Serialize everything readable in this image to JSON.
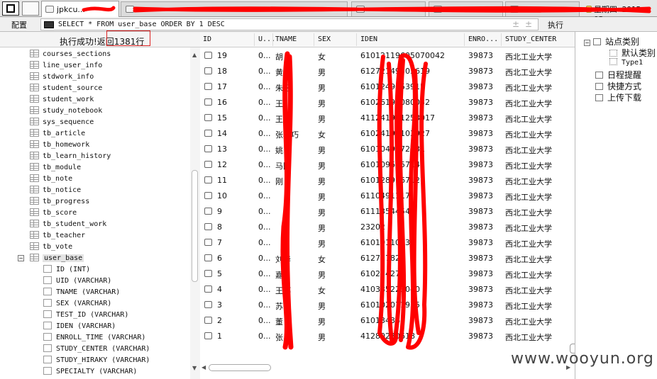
{
  "tabs": {
    "active_label": "jpkcu...",
    "date_label": "星期四 2015-05-"
  },
  "toolbar": {
    "config_label": "配置",
    "sql": "SELECT * FROM user_base ORDER BY 1 DESC",
    "exec_label": "执行",
    "arrow_up": "±",
    "arrow_down": "±"
  },
  "status": {
    "text": "执行成功!返回1381行"
  },
  "tree": {
    "tables": [
      "courses_sections",
      "line_user_info",
      "stdwork_info",
      "student_source",
      "student_work",
      "study_notebook",
      "sys_sequence",
      "tb_article",
      "tb_homework",
      "tb_learn_history",
      "tb_module",
      "tb_note",
      "tb_notice",
      "tb_progress",
      "tb_score",
      "tb_student_work",
      "tb_teacher",
      "tb_vote"
    ],
    "selected": "user_base",
    "columns": [
      "ID (INT)",
      "UID (VARCHAR)",
      "TNAME (VARCHAR)",
      "SEX (VARCHAR)",
      "TEST_ID (VARCHAR)",
      "IDEN (VARCHAR)",
      "ENROLL_TIME (VARCHAR)",
      "STUDY_CENTER (VARCHAR)",
      "STUDY_HIRAKY (VARCHAR)",
      "SPECIALTY (VARCHAR)"
    ]
  },
  "grid": {
    "headers": [
      "ID",
      "U...",
      "TNAME",
      "SEX",
      "IDEN",
      "ENRO...",
      "STUDY_CENTER"
    ],
    "rows": [
      {
        "id": "19",
        "uid": "0...",
        "name": "胡",
        "sex": "女",
        "iden": "61012119605070042",
        "enro": "39873",
        "center": "西北工业大学"
      },
      {
        "id": "18",
        "uid": "0...",
        "name": "黄",
        "sex": "男",
        "iden": "61272149503619",
        "enro": "39873",
        "center": "西北工业大学"
      },
      {
        "id": "17",
        "uid": "0...",
        "name": "朱召",
        "sex": "男",
        "iden": "6101249653915",
        "enro": "39873",
        "center": "西北工业大学"
      },
      {
        "id": "16",
        "uid": "0...",
        "name": "王",
        "sex": "男",
        "iden": "61026198080032",
        "enro": "39873",
        "center": "西北工业大学"
      },
      {
        "id": "15",
        "uid": "0...",
        "name": "王光",
        "sex": "男",
        "iden": "411241971253017",
        "enro": "39873",
        "center": "西北工业大学"
      },
      {
        "id": "14",
        "uid": "0...",
        "name": "张巧巧",
        "sex": "女",
        "iden": "61024198103927",
        "enro": "39873",
        "center": "西北工业大学"
      },
      {
        "id": "13",
        "uid": "0...",
        "name": "姚",
        "sex": "男",
        "iden": "6101049772131",
        "enro": "39873",
        "center": "西北工业大学"
      },
      {
        "id": "12",
        "uid": "0...",
        "name": "马国",
        "sex": "男",
        "iden": "610109615714",
        "enro": "39873",
        "center": "西北工业大学"
      },
      {
        "id": "11",
        "uid": "0...",
        "name": "刚",
        "sex": "男",
        "iden": "610128916712",
        "enro": "39873",
        "center": "西北工业大学"
      },
      {
        "id": "10",
        "uid": "0...",
        "name": "",
        "sex": "男",
        "iden": "6110491117",
        "enro": "39873",
        "center": "西北工业大学"
      },
      {
        "id": "9",
        "uid": "0...",
        "name": "",
        "sex": "男",
        "iden": "6111354454",
        "enro": "39873",
        "center": "西北工业大学"
      },
      {
        "id": "8",
        "uid": "0...",
        "name": "",
        "sex": "男",
        "iden": "23202",
        "enro": "39873",
        "center": "西北工业大学"
      },
      {
        "id": "7",
        "uid": "0...",
        "name": "",
        "sex": "男",
        "iden": "6101011053",
        "enro": "39873",
        "center": "西北工业大学"
      },
      {
        "id": "6",
        "uid": "0...",
        "name": "刘华",
        "sex": "女",
        "iden": "612727827",
        "enro": "39873",
        "center": "西北工业大学"
      },
      {
        "id": "5",
        "uid": "0...",
        "name": "嘉",
        "sex": "男",
        "iden": "61022427",
        "enro": "39873",
        "center": "西北工业大学"
      },
      {
        "id": "4",
        "uid": "0...",
        "name": "王娜",
        "sex": "女",
        "iden": "410385223040",
        "enro": "39873",
        "center": "西北工业大学"
      },
      {
        "id": "3",
        "uid": "0...",
        "name": "苏平",
        "sex": "男",
        "iden": "610102071915",
        "enro": "39873",
        "center": "西北工业大学"
      },
      {
        "id": "2",
        "uid": "0...",
        "name": "董",
        "sex": "男",
        "iden": "61013436",
        "enro": "39873",
        "center": "西北工业大学"
      },
      {
        "id": "1",
        "uid": "0...",
        "name": "张",
        "sex": "男",
        "iden": "41280230618",
        "enro": "39873",
        "center": "西北工业大学"
      }
    ]
  },
  "right_panel": {
    "items": [
      "站点类别",
      "默认类别",
      "Type1",
      "日程提醒",
      "快捷方式",
      "上传下载"
    ]
  },
  "watermark": "www.wooyun.org",
  "colors": {
    "redact": "#ff0000",
    "highlight_box": "#dd2222"
  }
}
